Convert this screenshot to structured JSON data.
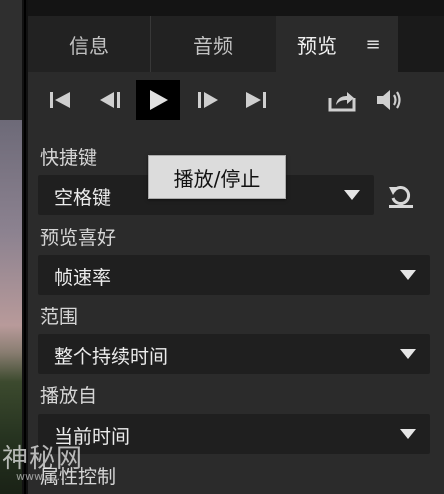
{
  "tabs": [
    {
      "label": "信息"
    },
    {
      "label": "音频"
    },
    {
      "label": "预览"
    }
  ],
  "tab_menu_icon": "hamburger-menu-icon",
  "transport": {
    "icons": [
      "go-to-start-icon",
      "step-back-icon",
      "play-icon",
      "step-forward-icon",
      "go-to-end-icon",
      "export-icon",
      "volume-icon"
    ]
  },
  "tooltip": "播放/停止",
  "shortcut": {
    "label": "快捷键",
    "value": "空格键"
  },
  "preference": {
    "label": "预览喜好",
    "value": "帧速率"
  },
  "range": {
    "label": "范围",
    "value": "整个持续时间"
  },
  "play_from": {
    "label": "播放自",
    "value": "当前时间"
  },
  "partial_label": "属性控制",
  "watermark": {
    "text": "神秘网",
    "sub": "www.……"
  },
  "colors": {
    "panel": "#2b2b2b",
    "tab_bar": "#222222",
    "active_play_bg": "#000000",
    "tooltip_bg": "#dcdcdc"
  }
}
